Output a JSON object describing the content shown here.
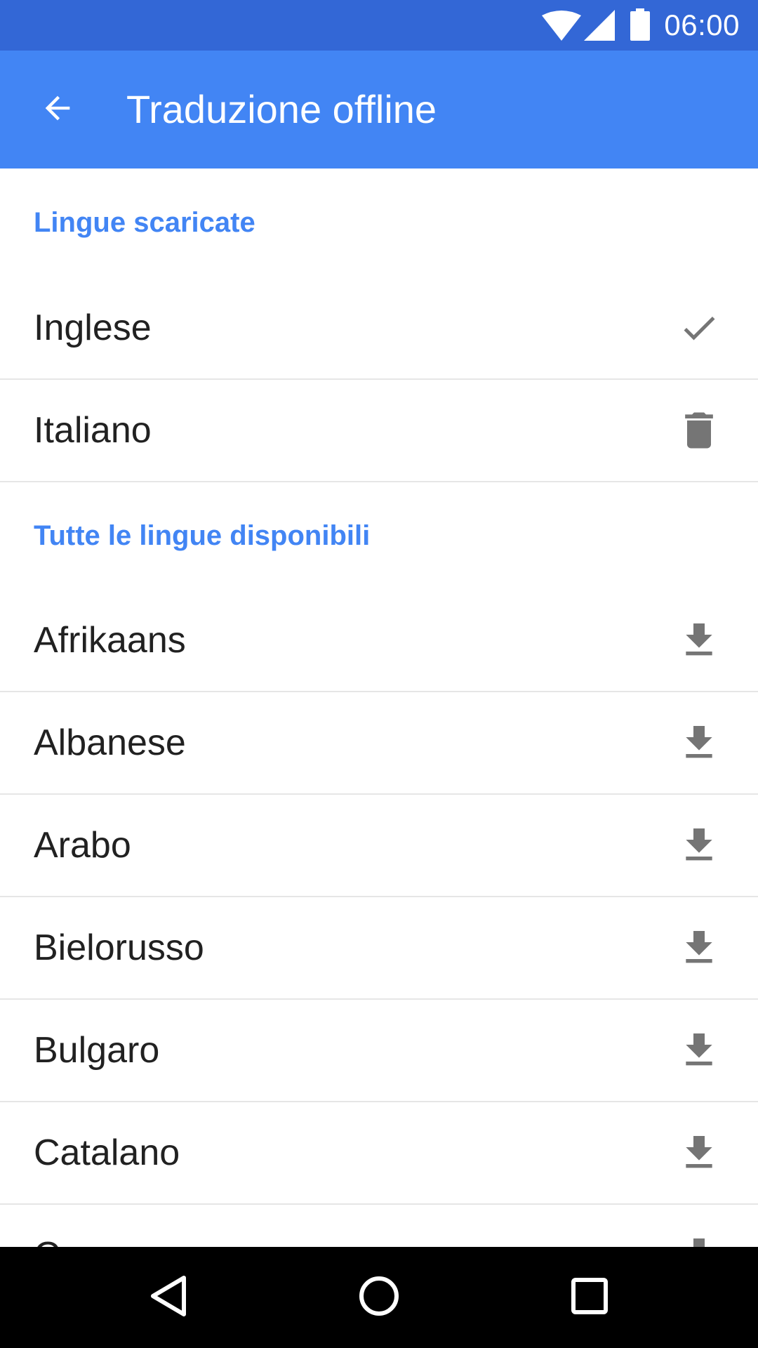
{
  "status_bar": {
    "time": "06:00",
    "icons": [
      "wifi-icon",
      "cell-signal-icon",
      "battery-icon"
    ]
  },
  "app_bar": {
    "title": "Traduzione offline",
    "back_icon": "arrow-back-icon"
  },
  "sections": {
    "downloaded": {
      "header": "Lingue scaricate",
      "items": [
        {
          "label": "Inglese",
          "action_icon": "check-icon"
        },
        {
          "label": "Italiano",
          "action_icon": "trash-icon"
        }
      ]
    },
    "available": {
      "header": "Tutte le lingue disponibili",
      "items": [
        {
          "label": "Afrikaans",
          "action_icon": "download-icon"
        },
        {
          "label": "Albanese",
          "action_icon": "download-icon"
        },
        {
          "label": "Arabo",
          "action_icon": "download-icon"
        },
        {
          "label": "Bielorusso",
          "action_icon": "download-icon"
        },
        {
          "label": "Bulgaro",
          "action_icon": "download-icon"
        },
        {
          "label": "Catalano",
          "action_icon": "download-icon"
        },
        {
          "label": "C",
          "action_icon": "download-icon"
        }
      ]
    }
  },
  "nav_bar": {
    "icons": [
      "nav-back-icon",
      "nav-home-icon",
      "nav-recents-icon"
    ]
  },
  "colors": {
    "status_bar": "#3367d6",
    "app_bar": "#4285f4",
    "section_header": "#4285f4",
    "icon_gray": "#757575",
    "divider": "#e6e6e6"
  }
}
